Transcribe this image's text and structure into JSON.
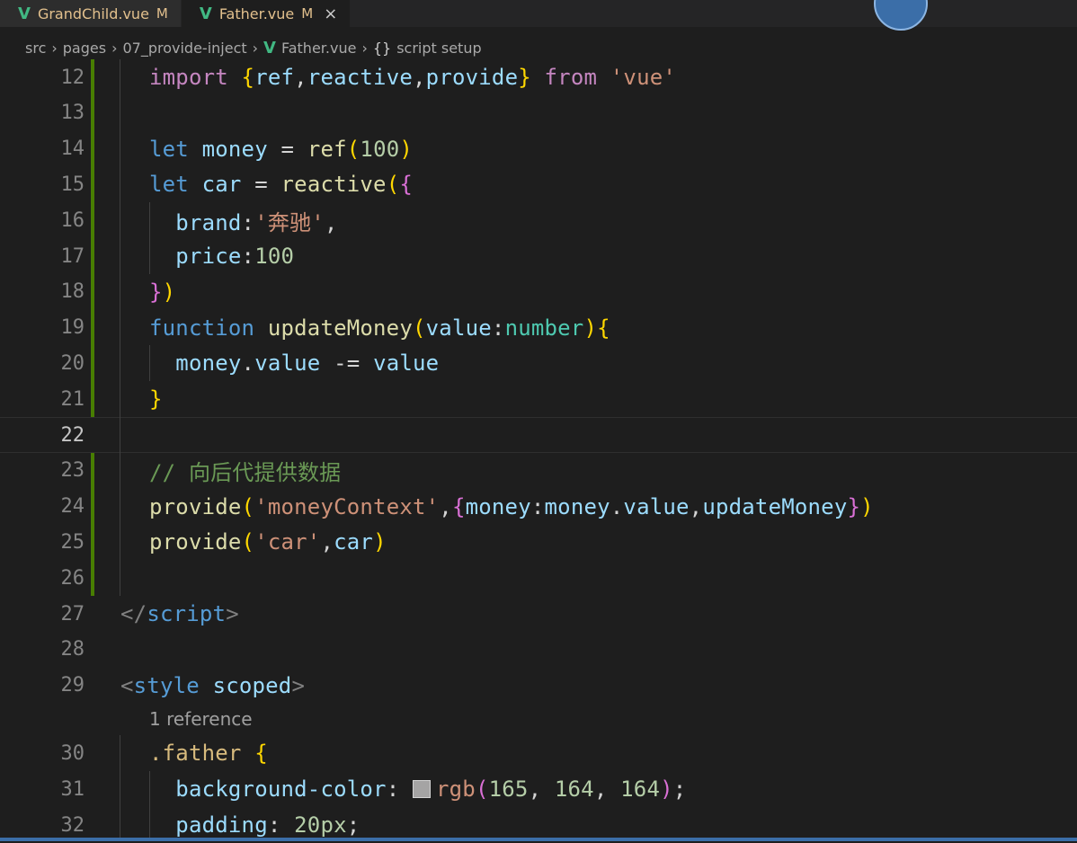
{
  "tabs": [
    {
      "name": "GrandChild.vue",
      "status": "M",
      "active": false
    },
    {
      "name": "Father.vue",
      "status": "M",
      "active": true,
      "close": "×"
    }
  ],
  "icons": {
    "vue": "vue-file-icon",
    "close": "close-icon"
  },
  "breadcrumb": {
    "items": [
      "src",
      "pages",
      "07_provide-inject",
      "Father.vue",
      "script setup"
    ],
    "separator": "›",
    "braces": "{}"
  },
  "editor": {
    "reference_lens": "1 reference",
    "color_swatch": "#a5a4a4",
    "lines": [
      {
        "n": "12",
        "tokens": [
          [
            "k-purple",
            "import "
          ],
          [
            "k-brace1",
            "{"
          ],
          [
            "k-var",
            "ref"
          ],
          [
            "k-text",
            ","
          ],
          [
            "k-var",
            "reactive"
          ],
          [
            "k-text",
            ","
          ],
          [
            "k-var",
            "provide"
          ],
          [
            "k-brace1",
            "}"
          ],
          [
            "k-purple",
            " from "
          ],
          [
            "k-str",
            "'vue'"
          ]
        ]
      },
      {
        "n": "13",
        "tokens": []
      },
      {
        "n": "14",
        "tokens": [
          [
            "k-blue",
            "let "
          ],
          [
            "k-var",
            "money"
          ],
          [
            "k-text",
            " = "
          ],
          [
            "k-func",
            "ref"
          ],
          [
            "k-brace1",
            "("
          ],
          [
            "k-num",
            "100"
          ],
          [
            "k-brace1",
            ")"
          ]
        ]
      },
      {
        "n": "15",
        "tokens": [
          [
            "k-blue",
            "let "
          ],
          [
            "k-var",
            "car"
          ],
          [
            "k-text",
            " = "
          ],
          [
            "k-func",
            "reactive"
          ],
          [
            "k-brace1",
            "("
          ],
          [
            "k-brace2",
            "{"
          ]
        ]
      },
      {
        "n": "16",
        "tokens": [
          [
            "k-var",
            "  brand"
          ],
          [
            "k-text",
            ":"
          ],
          [
            "k-str",
            "'奔驰'"
          ],
          [
            "k-text",
            ","
          ]
        ]
      },
      {
        "n": "17",
        "tokens": [
          [
            "k-var",
            "  price"
          ],
          [
            "k-text",
            ":"
          ],
          [
            "k-num",
            "100"
          ]
        ]
      },
      {
        "n": "18",
        "tokens": [
          [
            "k-brace2",
            "}"
          ],
          [
            "k-brace1",
            ")"
          ]
        ]
      },
      {
        "n": "19",
        "tokens": [
          [
            "k-blue",
            "function "
          ],
          [
            "k-func",
            "updateMoney"
          ],
          [
            "k-brace1",
            "("
          ],
          [
            "k-var",
            "value"
          ],
          [
            "k-text",
            ":"
          ],
          [
            "k-type",
            "number"
          ],
          [
            "k-brace1",
            ")"
          ],
          [
            "k-brace1",
            "{"
          ]
        ]
      },
      {
        "n": "20",
        "tokens": [
          [
            "k-var",
            "  money"
          ],
          [
            "k-text",
            "."
          ],
          [
            "k-var",
            "value"
          ],
          [
            "k-text",
            " -= "
          ],
          [
            "k-var",
            "value"
          ]
        ]
      },
      {
        "n": "21",
        "tokens": [
          [
            "k-brace1",
            "}"
          ]
        ]
      },
      {
        "n": "22",
        "tokens": [],
        "current": true
      },
      {
        "n": "23",
        "tokens": [
          [
            "k-comment",
            "// 向后代提供数据"
          ]
        ]
      },
      {
        "n": "24",
        "tokens": [
          [
            "k-func",
            "provide"
          ],
          [
            "k-brace1",
            "("
          ],
          [
            "k-str",
            "'moneyContext'"
          ],
          [
            "k-text",
            ","
          ],
          [
            "k-brace2",
            "{"
          ],
          [
            "k-var",
            "money"
          ],
          [
            "k-text",
            ":"
          ],
          [
            "k-var",
            "money"
          ],
          [
            "k-text",
            "."
          ],
          [
            "k-var",
            "value"
          ],
          [
            "k-text",
            ","
          ],
          [
            "k-var",
            "updateMoney"
          ],
          [
            "k-brace2",
            "}"
          ],
          [
            "k-brace1",
            ")"
          ]
        ]
      },
      {
        "n": "25",
        "tokens": [
          [
            "k-func",
            "provide"
          ],
          [
            "k-brace1",
            "("
          ],
          [
            "k-str",
            "'car'"
          ],
          [
            "k-text",
            ","
          ],
          [
            "k-var",
            "car"
          ],
          [
            "k-brace1",
            ")"
          ]
        ]
      },
      {
        "n": "26",
        "tokens": []
      },
      {
        "n": "27",
        "tokens": [
          [
            "k-punct",
            "</"
          ],
          [
            "k-tag",
            "script"
          ],
          [
            "k-punct",
            ">"
          ]
        ],
        "outer": true
      },
      {
        "n": "28",
        "tokens": [],
        "outer": true
      },
      {
        "n": "29",
        "tokens": [
          [
            "k-punct",
            "<"
          ],
          [
            "k-tag",
            "style "
          ],
          [
            "k-var",
            "scoped"
          ],
          [
            "k-punct",
            ">"
          ]
        ],
        "outer": true
      },
      {
        "n": "30",
        "tokens": [
          [
            "k-sel",
            ".father "
          ],
          [
            "k-brace1",
            "{"
          ]
        ]
      },
      {
        "n": "31",
        "tokens": [
          [
            "k-prop",
            "  background-color"
          ],
          [
            "k-text",
            ": "
          ],
          [
            "swatch",
            ""
          ],
          [
            "k-str",
            "rgb"
          ],
          [
            "k-brace2",
            "("
          ],
          [
            "k-num",
            "165"
          ],
          [
            "k-text",
            ", "
          ],
          [
            "k-num",
            "164"
          ],
          [
            "k-text",
            ", "
          ],
          [
            "k-num",
            "164"
          ],
          [
            "k-brace2",
            ")"
          ],
          [
            "k-text",
            ";"
          ]
        ]
      },
      {
        "n": "32",
        "tokens": [
          [
            "k-prop",
            "  padding"
          ],
          [
            "k-text",
            ": "
          ],
          [
            "k-num",
            "20px"
          ],
          [
            "k-text",
            ";"
          ]
        ]
      }
    ]
  }
}
